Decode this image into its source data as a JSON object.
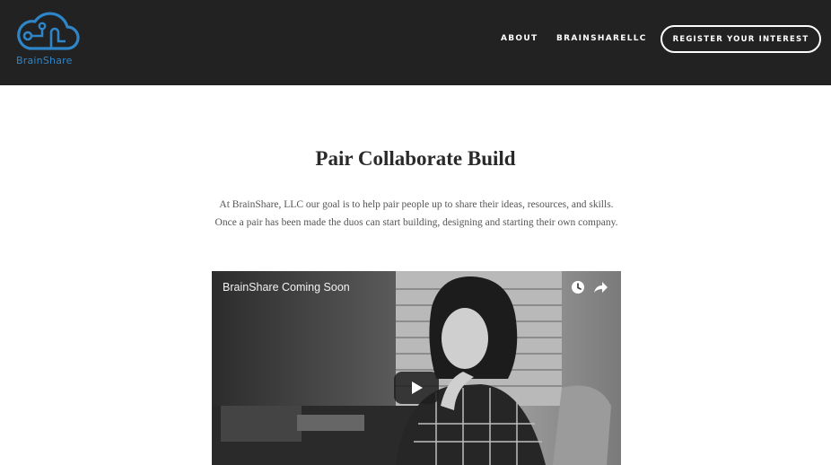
{
  "brand": {
    "name": "BrainShare",
    "color": "#2e86c9",
    "icon": "cloud-circuit-icon"
  },
  "nav": {
    "about": "ABOUT",
    "brainsharellc": "BRAINSHARELLC",
    "register": "REGISTER YOUR INTEREST"
  },
  "main": {
    "title": "Pair Collaborate Build",
    "intro": "At BrainShare, LLC our goal is to help pair people up to share their ideas, resources, and skills. Once a pair has been made the duos can start building, designing and starting their own company."
  },
  "video": {
    "title": "BrainShare Coming Soon",
    "icons": [
      "clock-icon",
      "share-icon",
      "play-icon"
    ]
  },
  "colors": {
    "header_bg": "#222222",
    "page_bg": "#ffffff"
  }
}
